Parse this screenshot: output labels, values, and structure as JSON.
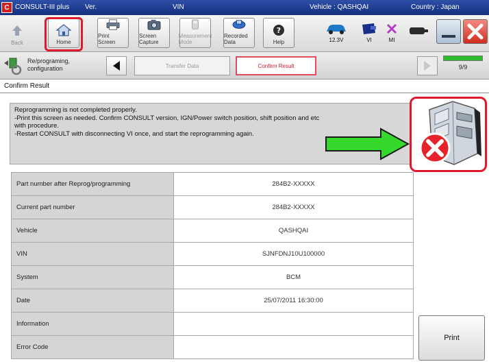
{
  "titlebar": {
    "logo": "C",
    "app_name": "CONSULT-III plus",
    "ver_label": "Ver.",
    "vin_label": "VIN",
    "vehicle_label": "Vehicle : QASHQAI",
    "country_label": "Country : Japan"
  },
  "toolbar": {
    "back": "Back",
    "home": "Home",
    "print_screen": "Print Screen",
    "screen_capture": "Screen Capture",
    "measurement_mode": "Measurement Mode",
    "recorded_data": "Recorded Data",
    "help": "Help",
    "battery_voltage": "12.3V",
    "vi_label": "VI",
    "mi_label": "MI"
  },
  "stepbar": {
    "label": "Re/programing, configuration",
    "transfer": "Transfer Data",
    "confirm": "Confirm Result",
    "progress_text": "9/9",
    "progress_fraction": 1.0
  },
  "screen_title": "Confirm Result",
  "message_lines": [
    "Reprogramming is not completed properly.",
    "-Print this screen as needed. Confirm CONSULT version, IGN/Power switch position, shift position and etc",
    "with procedure.",
    "-Restart CONSULT with disconnecting VI once, and start the reprogramming again."
  ],
  "table": {
    "rows": [
      {
        "label": "Part number after Reprog/programming",
        "value": "284B2-XXXXX"
      },
      {
        "label": "Current part number",
        "value": "284B2-XXXXX"
      },
      {
        "label": "Vehicle",
        "value": "QASHQAI"
      },
      {
        "label": "VIN",
        "value": "SJNFDNJ10U100000"
      },
      {
        "label": "System",
        "value": "BCM"
      },
      {
        "label": "Date",
        "value": "25/07/2011 16:30:00"
      },
      {
        "label": "Information",
        "value": ""
      },
      {
        "label": "Error Code",
        "value": ""
      }
    ]
  },
  "print_label": "Print",
  "colors": {
    "highlight_red": "#e0182d",
    "arrow_green": "#35d92c",
    "error_red": "#e8222b",
    "progress_green": "#2dbd2d"
  }
}
